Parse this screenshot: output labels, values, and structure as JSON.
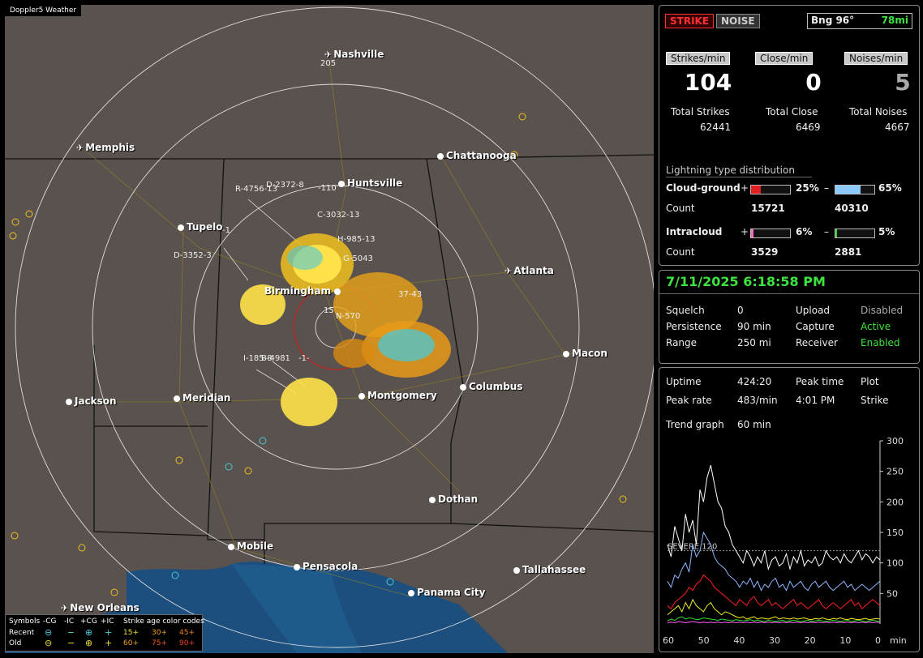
{
  "app_title": "Doppler5 Weather",
  "map": {
    "cities": [
      {
        "name": "Nashville",
        "type": "airport"
      },
      {
        "name": "Memphis",
        "type": "airport"
      },
      {
        "name": "Chattanooga",
        "type": "city"
      },
      {
        "name": "Huntsville",
        "type": "city"
      },
      {
        "name": "Tupelo",
        "type": "city"
      },
      {
        "name": "Atlanta",
        "type": "airport"
      },
      {
        "name": "Birmingham",
        "type": "city"
      },
      {
        "name": "Macon",
        "type": "city"
      },
      {
        "name": "Columbus",
        "type": "city"
      },
      {
        "name": "Jackson",
        "type": "city"
      },
      {
        "name": "Meridian",
        "type": "city"
      },
      {
        "name": "Montgomery",
        "type": "city"
      },
      {
        "name": "Dothan",
        "type": "city"
      },
      {
        "name": "Mobile",
        "type": "city"
      },
      {
        "name": "Pensacola",
        "type": "city"
      },
      {
        "name": "Tallahassee",
        "type": "city"
      },
      {
        "name": "Panama City",
        "type": "city"
      },
      {
        "name": "New Orleans",
        "type": "airport"
      }
    ],
    "range_ring_label": "205",
    "inner_ring_label": "15",
    "storm_tags": [
      {
        "text": "D-2372-8"
      },
      {
        "text": "-110"
      },
      {
        "text": "R-4756-13"
      },
      {
        "text": "C-3032-13"
      },
      {
        "text": "-1"
      },
      {
        "text": "H-985-13"
      },
      {
        "text": "D-3352-3"
      },
      {
        "text": "G-5043"
      },
      {
        "text": "37-43"
      },
      {
        "text": "N-570"
      },
      {
        "text": "I-185-8"
      },
      {
        "text": "B-4981"
      },
      {
        "text": "-1-"
      }
    ]
  },
  "legend": {
    "symbols_label": "Symbols",
    "cg_neg": "-CG",
    "ic_neg": "-IC",
    "cg_pos": "+CG",
    "ic_pos": "+IC",
    "age_title": "Strike age color codes",
    "recent_label": "Recent",
    "old_label": "Old",
    "recent_ages": [
      "15+",
      "30+",
      "45+"
    ],
    "old_ages": [
      "60+",
      "75+",
      "90+"
    ]
  },
  "status": {
    "strike_btn": "STRIKE",
    "noise_btn": "NOISE",
    "bearing": "Bng 96°",
    "distance": "78mi",
    "strikes_min_label": "Strikes/min",
    "close_min_label": "Close/min",
    "noises_min_label": "Noises/min",
    "strikes_min": "104",
    "close_min": "0",
    "noises_min": "5",
    "total_strikes_label": "Total Strikes",
    "total_close_label": "Total Close",
    "total_noises_label": "Total Noises",
    "total_strikes": "62441",
    "total_close": "6469",
    "total_noises": "4667",
    "dist_title": "Lightning type distribution",
    "cloud_ground_label": "Cloud-ground",
    "plus": "+",
    "minus": "–",
    "cg_pos_pct": "25%",
    "cg_neg_pct": "65%",
    "count_label": "Count",
    "cg_pos_count": "15721",
    "cg_neg_count": "40310",
    "intracloud_label": "Intracloud",
    "ic_pos_pct": "6%",
    "ic_neg_pct": "5%",
    "ic_pos_count": "3529",
    "ic_neg_count": "2881",
    "cg_pos_frac": 0.25,
    "cg_neg_frac": 0.65,
    "ic_pos_frac": 0.06,
    "ic_neg_frac": 0.05
  },
  "settings": {
    "datetime": "7/11/2025 6:18:58 PM",
    "squelch_label": "Squelch",
    "squelch": "0",
    "upload_label": "Upload",
    "upload": "Disabled",
    "persistence_label": "Persistence",
    "persistence": "90 min",
    "capture_label": "Capture",
    "capture": "Active",
    "range_label": "Range",
    "range": "250 mi",
    "receiver_label": "Receiver",
    "receiver": "Enabled"
  },
  "trend": {
    "uptime_label": "Uptime",
    "uptime": "424:20",
    "peak_time_label": "Peak time",
    "peak_time": "4:01 PM",
    "plot_label": "Plot",
    "plot": "Strike",
    "peak_rate_label": "Peak rate",
    "peak_rate": "483/min",
    "trend_graph_label": "Trend graph",
    "trend_graph": "60 min",
    "severe_label": "SEVERE 120",
    "x_unit": "min"
  },
  "chart_data": {
    "type": "line",
    "x_ticks": [
      "60",
      "50",
      "40",
      "30",
      "20",
      "10",
      "0"
    ],
    "y_ticks": [
      "300",
      "250",
      "200",
      "150",
      "100",
      "50"
    ],
    "ylim": [
      0,
      300
    ],
    "severe_threshold": 120,
    "series": [
      {
        "color": "#ffffff",
        "values": [
          130,
          110,
          160,
          140,
          120,
          180,
          150,
          170,
          130,
          220,
          200,
          240,
          260,
          230,
          200,
          190,
          160,
          150,
          130,
          120,
          110,
          100,
          120,
          110,
          95,
          110,
          100,
          120,
          90,
          105,
          110,
          95,
          100,
          115,
          90,
          110,
          100,
          120,
          95,
          105,
          100,
          110,
          95,
          100,
          120,
          110,
          105,
          110,
          100,
          115,
          105,
          100,
          110,
          120,
          105,
          115,
          110,
          100,
          110,
          105
        ]
      },
      {
        "color": "#8fb8ff",
        "values": [
          70,
          60,
          80,
          75,
          90,
          100,
          85,
          130,
          110,
          120,
          150,
          140,
          130,
          110,
          100,
          95,
          90,
          80,
          75,
          70,
          60,
          70,
          65,
          75,
          60,
          70,
          55,
          65,
          60,
          70,
          75,
          60,
          65,
          55,
          70,
          60,
          65,
          70,
          60,
          55,
          65,
          70,
          60,
          65,
          70,
          60,
          55,
          60,
          65,
          70,
          60,
          65,
          55,
          60,
          65,
          60,
          55,
          60,
          65,
          70
        ]
      },
      {
        "color": "#ff2020",
        "values": [
          30,
          25,
          35,
          40,
          45,
          50,
          60,
          55,
          65,
          70,
          80,
          75,
          70,
          60,
          55,
          50,
          45,
          40,
          35,
          30,
          40,
          35,
          30,
          40,
          45,
          35,
          30,
          35,
          40,
          30,
          35,
          30,
          25,
          30,
          35,
          40,
          30,
          35,
          30,
          25,
          30,
          35,
          40,
          30,
          25,
          30,
          35,
          30,
          25,
          30,
          35,
          40,
          30,
          35,
          25,
          30,
          35,
          40,
          35,
          30
        ]
      },
      {
        "color": "#f0f020",
        "values": [
          15,
          20,
          25,
          30,
          20,
          35,
          25,
          40,
          30,
          25,
          20,
          30,
          35,
          25,
          20,
          15,
          20,
          18,
          15,
          12,
          10,
          12,
          8,
          10,
          12,
          8,
          10,
          9,
          8,
          10,
          12,
          8,
          10,
          9,
          8,
          10,
          8,
          9,
          10,
          8,
          7,
          9,
          8,
          10,
          8,
          7,
          9,
          8,
          10,
          8,
          7,
          9,
          8,
          7,
          8,
          9,
          7,
          8,
          9,
          8
        ]
      },
      {
        "color": "#30e030",
        "values": [
          5,
          8,
          6,
          10,
          12,
          8,
          10,
          9,
          7,
          8,
          10,
          9,
          8,
          7,
          6,
          8,
          7,
          6,
          5,
          7,
          6,
          5,
          6,
          7,
          5,
          6,
          5,
          4,
          6,
          5,
          4,
          5,
          6,
          4,
          5,
          6,
          5,
          4,
          5,
          6,
          4,
          5,
          6,
          5,
          4,
          5,
          6,
          5,
          4,
          5,
          6,
          4,
          5,
          6,
          5,
          4,
          5,
          6,
          5,
          4
        ]
      },
      {
        "color": "#ff60ff",
        "values": [
          2,
          3,
          2,
          4,
          3,
          2,
          3,
          4,
          3,
          2,
          3,
          2,
          3,
          2,
          3,
          2,
          3,
          2,
          3,
          2,
          3,
          2,
          3,
          2,
          3,
          2,
          3,
          2,
          3,
          2,
          3,
          2,
          3,
          2,
          3,
          2,
          3,
          2,
          3,
          2,
          3,
          2,
          3,
          2,
          3,
          2,
          3,
          2,
          3,
          2,
          3,
          2,
          3,
          2,
          3,
          2,
          3,
          2,
          3,
          2
        ]
      }
    ]
  }
}
